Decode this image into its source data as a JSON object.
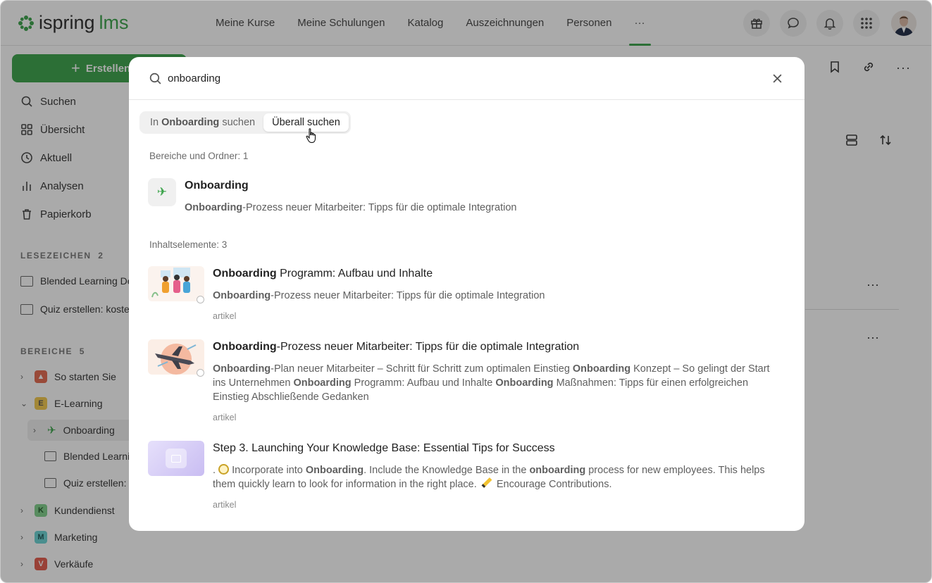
{
  "app": {
    "logo_main": "ispring",
    "logo_accent": "lms"
  },
  "nav": {
    "items": [
      "Meine Kurse",
      "Meine Schulungen",
      "Katalog",
      "Auszeichnungen",
      "Personen",
      "···"
    ]
  },
  "sidebar": {
    "create_label": "Erstellen",
    "items": [
      "Suchen",
      "Übersicht",
      "Aktuell",
      "Analysen",
      "Papierkorb"
    ],
    "bookmarks_header": "LESEZEICHEN",
    "bookmarks_count": "2",
    "bookmarks": [
      "Blended Learning De",
      "Quiz erstellen: koste"
    ],
    "areas_header": "BEREICHE",
    "areas_count": "5",
    "areas": [
      {
        "badge": "",
        "label": "So starten Sie"
      },
      {
        "badge": "E",
        "label": "E-Learning"
      },
      {
        "badge": "",
        "label": "Onboarding"
      },
      {
        "badge": "",
        "label": "Blended Learni"
      },
      {
        "badge": "",
        "label": "Quiz erstellen: K"
      },
      {
        "badge": "K",
        "label": "Kundendienst"
      },
      {
        "badge": "M",
        "label": "Marketing"
      },
      {
        "badge": "V",
        "label": "Verkäufe"
      }
    ]
  },
  "search": {
    "value": "onboarding",
    "tab_local_prefix": "In ",
    "tab_local_bold": "Onboarding",
    "tab_local_suffix": " suchen",
    "tab_global": "Überall suchen",
    "section_areas": "Bereiche und Ordner: 1",
    "section_content": "Inhaltselemente: 3",
    "folder": {
      "title": "Onboarding",
      "desc_bold": "Onboarding",
      "desc_rest": "-Prozess neuer Mitarbeiter: Tipps für die optimale Integration"
    },
    "results": [
      {
        "title_bold": "Onboarding",
        "title_rest": " Programm: Aufbau und Inhalte",
        "desc_bold": "Onboarding",
        "desc_rest": "-Prozess neuer Mitarbeiter: Tipps für die optimale Integration",
        "type": "artikel"
      },
      {
        "title_bold": "Onboarding",
        "title_rest": "-Prozess neuer Mitarbeiter: Tipps für die optimale Integration",
        "desc_parts": [
          "Onboarding",
          "-Plan neuer Mitarbeiter – Schritt für Schritt zum optimalen Einstieg ",
          "Onboarding",
          " Konzept – So gelingt der Start ins Unternehmen ",
          "Onboarding",
          " Programm: Aufbau und Inhalte ",
          "Onboarding",
          " Maßnahmen: Tipps für einen erfolgreichen Einstieg Abschließende Gedanken"
        ],
        "type": "artikel"
      },
      {
        "title": "Step 3. Launching Your Knowledge Base: Essential Tips for Success",
        "desc_parts": [
          ". ",
          " Incorporate into ",
          "Onboarding",
          ". Include the Knowledge Base in the ",
          "onboarding",
          " process for new employees. This helps them quickly learn to look for information in the right place. ",
          " Encourage Contributions."
        ],
        "type": "artikel"
      }
    ]
  },
  "colors": {
    "brand": "#3aa34a",
    "overlay": "rgba(20,20,20,0.36)"
  }
}
